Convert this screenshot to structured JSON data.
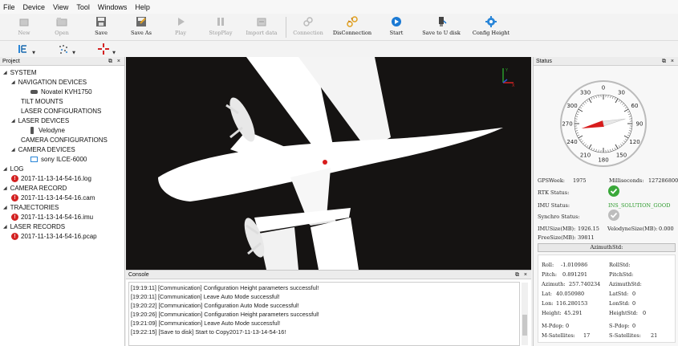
{
  "menu": [
    "File",
    "Device",
    "View",
    "Tool",
    "Windows",
    "Help"
  ],
  "toolbar": {
    "buttons": [
      {
        "label": "New",
        "icon": "new-icon",
        "enabled": false
      },
      {
        "label": "Open",
        "icon": "open-icon",
        "enabled": false
      },
      {
        "label": "Save",
        "icon": "save-icon",
        "enabled": true
      },
      {
        "label": "Save As",
        "icon": "save-as-icon",
        "enabled": true
      },
      {
        "label": "Play",
        "icon": "play-icon",
        "enabled": false
      },
      {
        "label": "StopPlay",
        "icon": "stop-play-icon",
        "enabled": false
      },
      {
        "label": "Import data",
        "icon": "import-icon",
        "enabled": false
      },
      {
        "label": "Connection",
        "icon": "connection-icon",
        "enabled": false
      },
      {
        "label": "DisConnection",
        "icon": "disconnection-icon",
        "enabled": true
      },
      {
        "label": "Start",
        "icon": "start-icon",
        "enabled": true
      },
      {
        "label": "Save to U disk",
        "icon": "usb-icon",
        "enabled": true
      },
      {
        "label": "Config Height",
        "icon": "gear-icon",
        "enabled": true
      }
    ]
  },
  "project": {
    "title": "Project",
    "tree": {
      "system": "SYSTEM",
      "navigation_devices": "NAVIGATION DEVICES",
      "novatel": "Novatel KVH1750",
      "tilt_mounts": "TILT MOUNTS",
      "laser_configurations": "LASER CONFIGURATIONS",
      "laser_devices": "LASER DEVICES",
      "velodyne": "Velodyne",
      "camera_configurations": "CAMERA CONFIGURATIONS",
      "camera_devices": "CAMERA DEVICES",
      "sony": "sony ILCE-6000",
      "log": "LOG",
      "log_file": "2017-11-13-14-54-16.log",
      "camera_record": "CAMERA RECORD",
      "cam_file": "2017-11-13-14-54-16.cam",
      "trajectories": "TRAJECTORIES",
      "imu_file": "2017-11-13-14-54-16.imu",
      "laser_records": "LASER RECORDS",
      "pcap_file": "2017-11-13-14-54-16.pcap"
    }
  },
  "console": {
    "title": "Console",
    "lines": [
      "[19:19:11] [Communication]  Configuration Height parameters successful!",
      "[19:20:11] [Communication]  Leave Auto Mode successful!",
      "[19:20:22] [Communication]  Configuration Auto Mode successful!",
      "[19:20:26] [Communication]  Configuration Height parameters successful!",
      "[19:21:09] [Communication]  Leave Auto Mode successful!",
      "[19:22:15] [Save to disk]  Start to Copy2017-11-13-14-54-16!"
    ]
  },
  "status": {
    "title": "Status",
    "compass": {
      "ticks": [
        "0",
        "30",
        "60",
        "90",
        "120",
        "150",
        "180",
        "210",
        "240",
        "270",
        "300",
        "330"
      ],
      "heading_deg": 257.740234
    },
    "gps_week_label": "GPSWeek:",
    "gps_week": "1975",
    "milliseconds_label": "Milliseconds:",
    "milliseconds": "127286800",
    "rtk_label": "RTK Status:",
    "imu_label": "IMU Status:",
    "imu_value": "INS_SOLUTION_GOOD",
    "synchro_label": "Synchro Status:",
    "imu_size_label": "IMUSize(MB):",
    "imu_size": "1926.15",
    "velodyne_size_label": "VelodyneSize(MB):",
    "velodyne_size": "0.000",
    "free_size_label": "FreeSize(MB):",
    "free_size": "39811",
    "azimuth_std_label": "AzimuthStd:",
    "roll_label": "Roll:",
    "roll": "-1.010986",
    "pitch_label": "Pitch:",
    "pitch": "0.891291",
    "azimuth_label": "Azimuth:",
    "azimuth": "257.740234",
    "lat_label": "Lat:",
    "lat": "40.050980",
    "lon_label": "Lon:",
    "lon": "116.280153",
    "height_label": "Height:",
    "height": "45.291",
    "roll_std_label": "RollStd:",
    "pitch_std_label": "PitchStd:",
    "azimuth_std_label2": "AzimuthStd:",
    "lat_std_label": "LatStd:",
    "lat_std": "0",
    "lon_std_label": "LonStd:",
    "lon_std": "0",
    "height_std_label": "HeightStd:",
    "height_std": "0",
    "m_pdop_label": "M-Pdop:",
    "m_pdop": "0",
    "s_pdop_label": "S-Pdop:",
    "s_pdop": "0",
    "m_sat_label": "M-Satellites:",
    "m_sat": "17",
    "s_sat_label": "S-Satellites:",
    "s_sat": "21"
  },
  "colors": {
    "viewport_bg": "#151312",
    "ok_green": "#3aa83a",
    "record_red": "#d32222",
    "compass_needle": "#d81c1c"
  }
}
